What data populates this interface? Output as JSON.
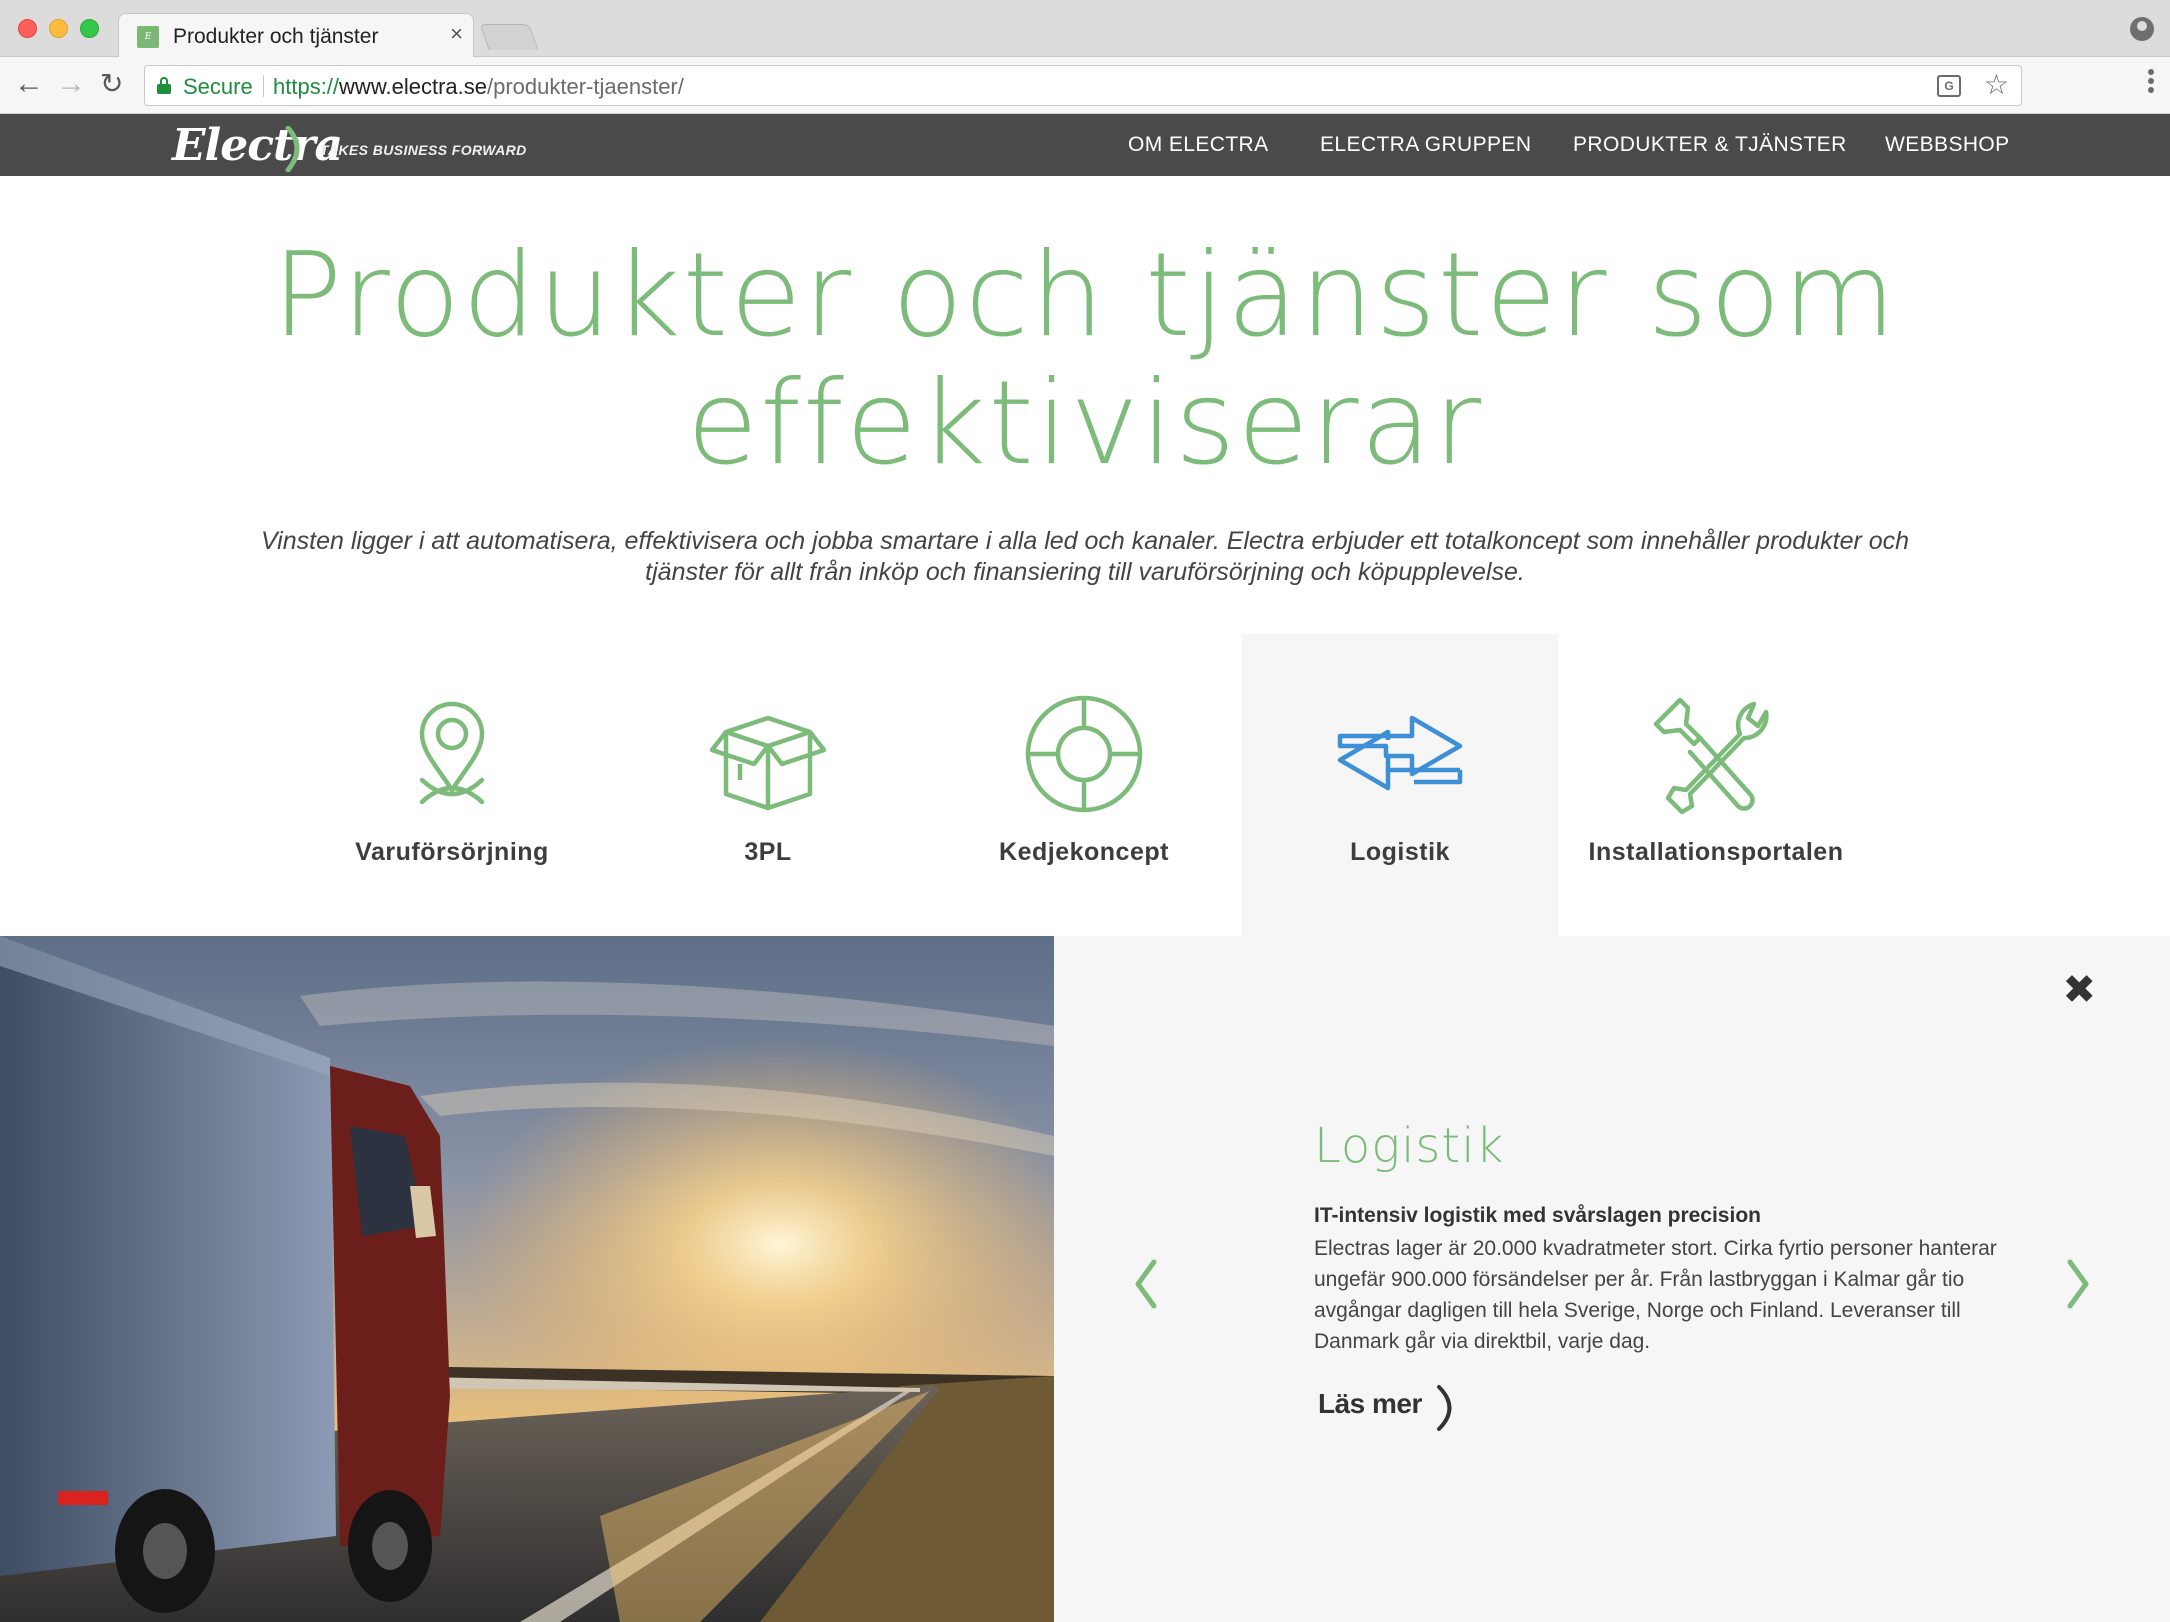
{
  "browser": {
    "tab_title": "Produkter och tjänster",
    "secure_label": "Secure",
    "url_scheme": "https://",
    "url_host": "www.electra.se",
    "url_path": "/produkter-tjaenster/"
  },
  "site": {
    "logo_text": "Electra",
    "tagline": "TAKES BUSINESS FORWARD",
    "menu": [
      {
        "label": "OM ELECTRA"
      },
      {
        "label": "ELECTRA GRUPPEN"
      },
      {
        "label": "PRODUKTER & TJÄNSTER"
      },
      {
        "label": "WEBBSHOP"
      }
    ]
  },
  "hero": {
    "title_line1": "Produkter och tjänster som",
    "title_line2": "effektiviserar",
    "lead_line1": "Vinsten ligger i att automatisera, effektivisera och jobba smartare i alla led och kanaler. Electra erbjuder ett totalkoncept som innehåller produkter och",
    "lead_line2": "tjänster för allt från inköp och finansiering till varuförsörjning och köpupplevelse."
  },
  "services": [
    {
      "label": "Varuförsörjning",
      "icon": "location-pin-icon"
    },
    {
      "label": "3PL",
      "icon": "box-icon"
    },
    {
      "label": "Kedjekoncept",
      "icon": "target-icon"
    },
    {
      "label": "Logistik",
      "icon": "exchange-arrows-icon",
      "active": true
    },
    {
      "label": "Installationsportalen",
      "icon": "tools-icon"
    }
  ],
  "detail": {
    "title": "Logistik",
    "subtitle": "IT-intensiv logistik med svårslagen precision",
    "body": "Electras lager är 20.000 kvadratmeter stort. Cirka fyrtio personer hanterar ungefär 900.000 försändelser per år. Från lastbryggan i Kalmar går tio avgångar dagligen till hela Sverige, Norge och Finland. Leveranser till Danmark går via direktbil, varje dag.",
    "read_more": "Läs mer"
  },
  "colors": {
    "brand_green": "#7cbb7a",
    "active_blue": "#3d8fd6",
    "nav_bg": "#4a4a4a",
    "panel_bg": "#f6f6f6"
  }
}
